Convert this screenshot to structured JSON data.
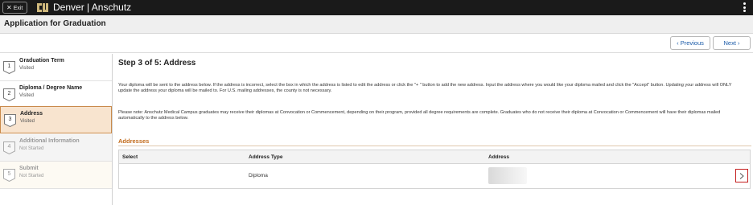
{
  "topbar": {
    "exit_label": "Exit",
    "brand": "Denver | Anschutz"
  },
  "page": {
    "title": "Application for Graduation"
  },
  "nav": {
    "previous_label": "Previous",
    "next_label": "Next"
  },
  "steps": [
    {
      "number": "1",
      "title": "Graduation Term",
      "status": "Visited"
    },
    {
      "number": "2",
      "title": "Diploma / Degree Name",
      "status": "Visited"
    },
    {
      "number": "3",
      "title": "Address",
      "status": "Visited"
    },
    {
      "number": "4",
      "title": "Additional Information",
      "status": "Not Started"
    },
    {
      "number": "5",
      "title": "Submit",
      "status": "Not Started"
    }
  ],
  "main": {
    "heading": "Step 3 of 5: Address",
    "paragraph1": "Your diploma will be sent to the address below. If the address is incorrect, select the box in which the address is listed to edit the address or click the \"+ \" button to add the new address. Input the address where you would like your diploma mailed and click the \"Accept\" button. Updating your address will ONLY update the address your diploma will be mailed to. For U.S. mailing addresses, the county is not necessary.",
    "paragraph2": "Please note: Anschutz Medical Campus graduates may receive their diplomas at Convocation or Commencement, depending on their program, provided all degree requirements are complete. Graduates who do not receive their diploma at Convocation or Commencement will have their diplomas mailed automatically to the address below.",
    "section_title": "Addresses"
  },
  "table": {
    "headers": {
      "select": "Select",
      "address_type": "Address Type",
      "address": "Address"
    },
    "rows": [
      {
        "select": "",
        "address_type": "Diploma",
        "address": ""
      }
    ]
  },
  "colors": {
    "topbar": "#1a1a1a",
    "active_step_bg": "#f8e4cf",
    "active_step_border": "#c98a4b",
    "section_title": "#c26a1a",
    "highlight_red": "#c41e1e",
    "link_blue": "#1a5aa8"
  }
}
